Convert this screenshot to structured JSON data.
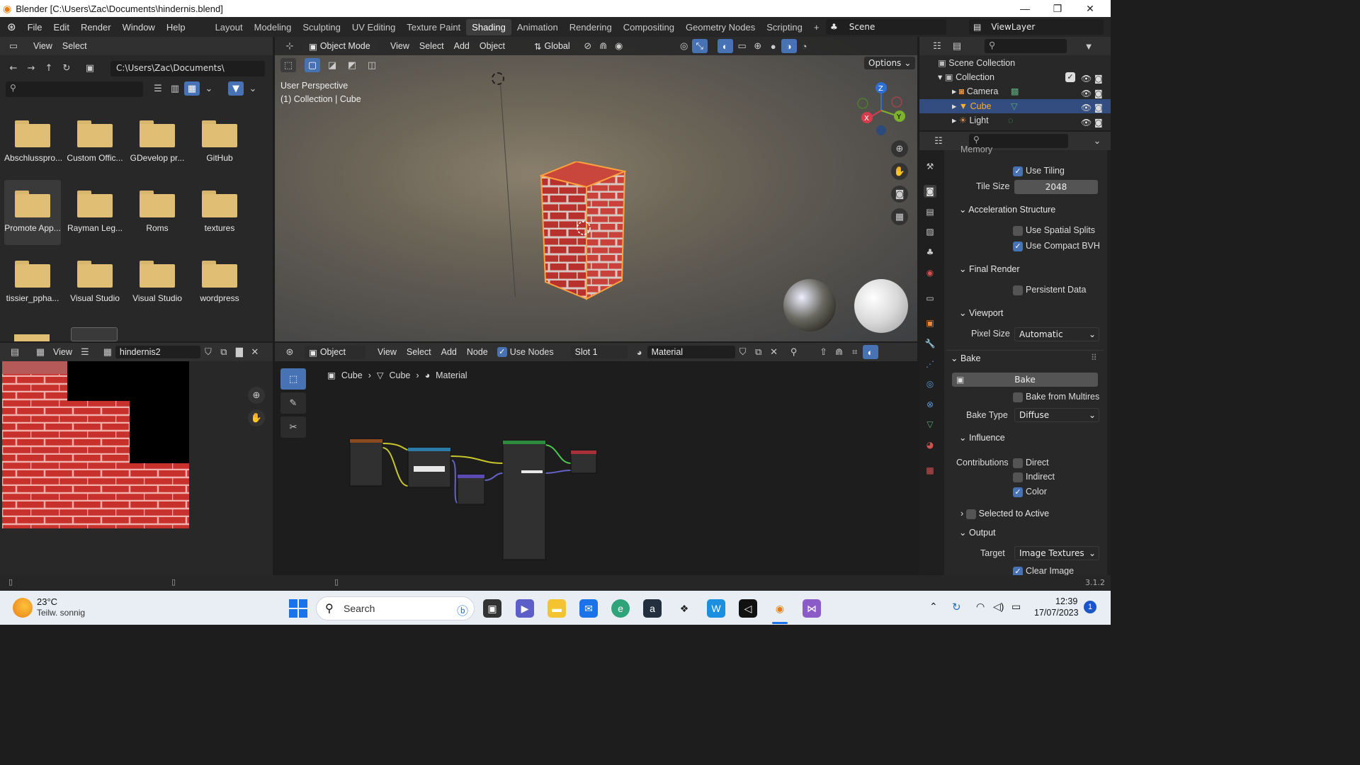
{
  "window": {
    "title": "Blender [C:\\Users\\Zac\\Documents\\hindernis.blend]"
  },
  "menu": [
    "File",
    "Edit",
    "Render",
    "Window",
    "Help"
  ],
  "workspaces": [
    "Layout",
    "Modeling",
    "Sculpting",
    "UV Editing",
    "Texture Paint",
    "Shading",
    "Animation",
    "Rendering",
    "Compositing",
    "Geometry Nodes",
    "Scripting"
  ],
  "active_workspace": "Shading",
  "scene": {
    "label": "Scene",
    "view_layer": "ViewLayer"
  },
  "file_browser": {
    "menu": [
      "View",
      "Select"
    ],
    "path": "C:\\Users\\Zac\\Documents\\",
    "folders": [
      "Abschlusspro...",
      "Custom Offic...",
      "GDevelop pr...",
      "GitHub",
      "Promote App...",
      "Rayman Leg...",
      "Roms",
      "textures",
      "tissier_ppha...",
      "Visual Studio",
      "Visual Studio",
      "wordpress"
    ]
  },
  "viewport": {
    "mode": "Object Mode",
    "menu": [
      "View",
      "Select",
      "Add",
      "Object"
    ],
    "transform": "Global",
    "options": "Options",
    "info_line1": "User Perspective",
    "info_line2": "(1) Collection | Cube",
    "gizmo": {
      "x": "X",
      "y": "Y",
      "z": "Z"
    }
  },
  "outliner": {
    "root": "Scene Collection",
    "collection": "Collection",
    "items": [
      "Camera",
      "Cube",
      "Light"
    ],
    "selected": "Cube"
  },
  "properties": {
    "memory_label": "Memory",
    "use_tiling": "Use Tiling",
    "tile_size_label": "Tile Size",
    "tile_size": "2048",
    "accel": "Acceleration Structure",
    "spatial": "Use Spatial Splits",
    "compact": "Use Compact BVH",
    "final_render": "Final Render",
    "persistent": "Persistent Data",
    "viewport": "Viewport",
    "pixel_size_label": "Pixel Size",
    "pixel_size": "Automatic",
    "bake": "Bake",
    "bake_button": "Bake",
    "multires": "Bake from Multires",
    "bake_type_label": "Bake Type",
    "bake_type": "Diffuse",
    "influence": "Influence",
    "contributions": "Contributions",
    "direct": "Direct",
    "indirect": "Indirect",
    "color": "Color",
    "selected_active": "Selected to Active",
    "output": "Output",
    "target_label": "Target",
    "target": "Image Textures",
    "clear_image": "Clear Image"
  },
  "image_editor": {
    "view": "View",
    "image_name": "hindernis2"
  },
  "node_editor": {
    "type": "Object",
    "menu": [
      "View",
      "Select",
      "Add",
      "Node"
    ],
    "use_nodes": "Use Nodes",
    "slot": "Slot 1",
    "material": "Material",
    "breadcrumb": [
      "Cube",
      "Cube",
      "Material"
    ]
  },
  "status_bar": {
    "version": "3.1.2"
  },
  "taskbar": {
    "weather_temp": "23°C",
    "weather_desc": "Teilw. sonnig",
    "search": "Search",
    "time": "12:39",
    "date": "17/07/2023",
    "notifications": "1"
  }
}
